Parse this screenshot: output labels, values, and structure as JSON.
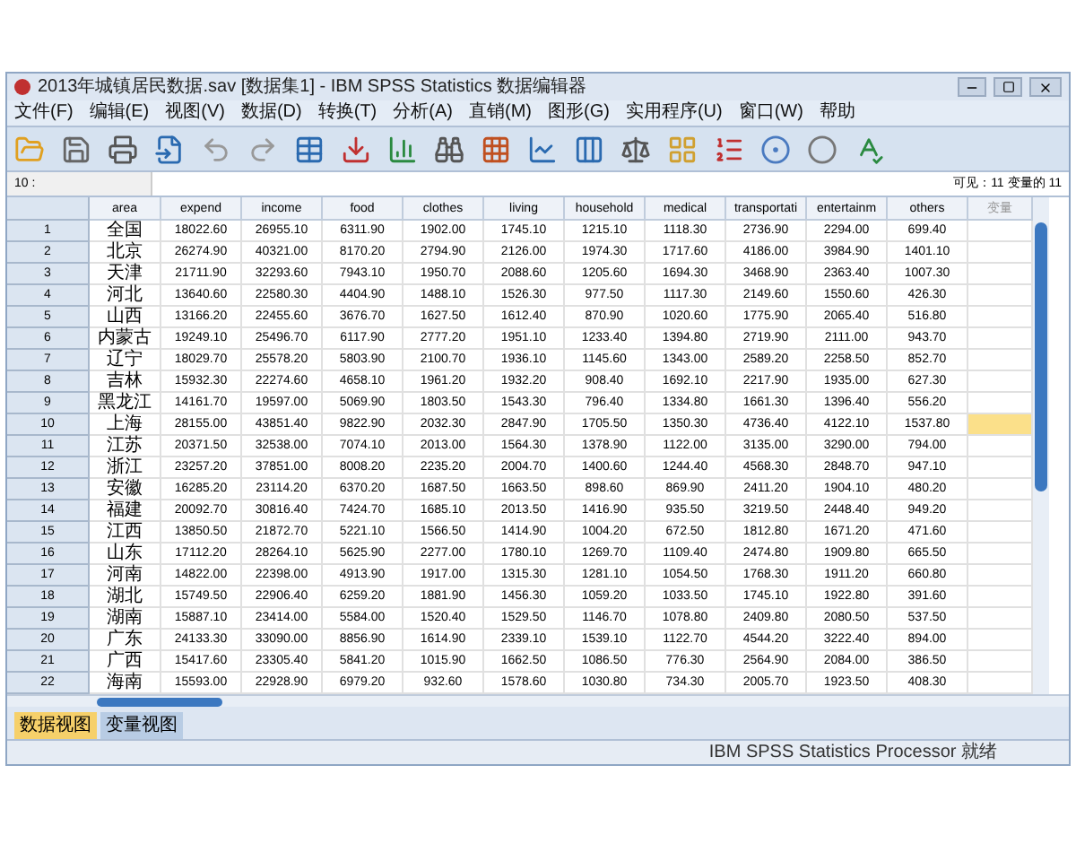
{
  "window": {
    "title": "2013年城镇居民数据.sav [数据集1] - IBM SPSS Statistics 数据编辑器"
  },
  "menu": [
    "文件(F)",
    "编辑(E)",
    "视图(V)",
    "数据(D)",
    "转换(T)",
    "分析(A)",
    "直销(M)",
    "图形(G)",
    "实用程序(U)",
    "窗口(W)",
    "帮助"
  ],
  "cell_editor": {
    "reference": "10 :",
    "visible_count": "可见：11 变量的 11"
  },
  "table": {
    "columns": [
      "area",
      "expend",
      "income",
      "food",
      "clothes",
      "living",
      "household",
      "medical",
      "transportati",
      "entertainm",
      "others",
      "变量"
    ],
    "rows": [
      {
        "number": "1",
        "cells": [
          "全国",
          "18022.60",
          "26955.10",
          "6311.90",
          "1902.00",
          "1745.10",
          "1215.10",
          "1118.30",
          "2736.90",
          "2294.00",
          "699.40"
        ],
        "selected": false
      },
      {
        "number": "2",
        "cells": [
          "北京",
          "26274.90",
          "40321.00",
          "8170.20",
          "2794.90",
          "2126.00",
          "1974.30",
          "1717.60",
          "4186.00",
          "3984.90",
          "1401.10"
        ],
        "selected": false
      },
      {
        "number": "3",
        "cells": [
          "天津",
          "21711.90",
          "32293.60",
          "7943.10",
          "1950.70",
          "2088.60",
          "1205.60",
          "1694.30",
          "3468.90",
          "2363.40",
          "1007.30"
        ],
        "selected": false
      },
      {
        "number": "4",
        "cells": [
          "河北",
          "13640.60",
          "22580.30",
          "4404.90",
          "1488.10",
          "1526.30",
          "977.50",
          "1117.30",
          "2149.60",
          "1550.60",
          "426.30"
        ],
        "selected": false
      },
      {
        "number": "5",
        "cells": [
          "山西",
          "13166.20",
          "22455.60",
          "3676.70",
          "1627.50",
          "1612.40",
          "870.90",
          "1020.60",
          "1775.90",
          "2065.40",
          "516.80"
        ],
        "selected": false
      },
      {
        "number": "6",
        "cells": [
          "内蒙古",
          "19249.10",
          "25496.70",
          "6117.90",
          "2777.20",
          "1951.10",
          "1233.40",
          "1394.80",
          "2719.90",
          "2111.00",
          "943.70"
        ],
        "selected": false
      },
      {
        "number": "7",
        "cells": [
          "辽宁",
          "18029.70",
          "25578.20",
          "5803.90",
          "2100.70",
          "1936.10",
          "1145.60",
          "1343.00",
          "2589.20",
          "2258.50",
          "852.70"
        ],
        "selected": false
      },
      {
        "number": "8",
        "cells": [
          "吉林",
          "15932.30",
          "22274.60",
          "4658.10",
          "1961.20",
          "1932.20",
          "908.40",
          "1692.10",
          "2217.90",
          "1935.00",
          "627.30"
        ],
        "selected": false
      },
      {
        "number": "9",
        "cells": [
          "黑龙江",
          "14161.70",
          "19597.00",
          "5069.90",
          "1803.50",
          "1543.30",
          "796.40",
          "1334.80",
          "1661.30",
          "1396.40",
          "556.20"
        ],
        "selected": false
      },
      {
        "number": "10",
        "cells": [
          "上海",
          "28155.00",
          "43851.40",
          "9822.90",
          "2032.30",
          "2847.90",
          "1705.50",
          "1350.30",
          "4736.40",
          "4122.10",
          "1537.80"
        ],
        "selected": true
      },
      {
        "number": "11",
        "cells": [
          "江苏",
          "20371.50",
          "32538.00",
          "7074.10",
          "2013.00",
          "1564.30",
          "1378.90",
          "1122.00",
          "3135.00",
          "3290.00",
          "794.00"
        ],
        "selected": false
      },
      {
        "number": "12",
        "cells": [
          "浙江",
          "23257.20",
          "37851.00",
          "8008.20",
          "2235.20",
          "2004.70",
          "1400.60",
          "1244.40",
          "4568.30",
          "2848.70",
          "947.10"
        ],
        "selected": false
      },
      {
        "number": "13",
        "cells": [
          "安徽",
          "16285.20",
          "23114.20",
          "6370.20",
          "1687.50",
          "1663.50",
          "898.60",
          "869.90",
          "2411.20",
          "1904.10",
          "480.20"
        ],
        "selected": false
      },
      {
        "number": "14",
        "cells": [
          "福建",
          "20092.70",
          "30816.40",
          "7424.70",
          "1685.10",
          "2013.50",
          "1416.90",
          "935.50",
          "3219.50",
          "2448.40",
          "949.20"
        ],
        "selected": false
      },
      {
        "number": "15",
        "cells": [
          "江西",
          "13850.50",
          "21872.70",
          "5221.10",
          "1566.50",
          "1414.90",
          "1004.20",
          "672.50",
          "1812.80",
          "1671.20",
          "471.60"
        ],
        "selected": false
      },
      {
        "number": "16",
        "cells": [
          "山东",
          "17112.20",
          "28264.10",
          "5625.90",
          "2277.00",
          "1780.10",
          "1269.70",
          "1109.40",
          "2474.80",
          "1909.80",
          "665.50"
        ],
        "selected": false
      },
      {
        "number": "17",
        "cells": [
          "河南",
          "14822.00",
          "22398.00",
          "4913.90",
          "1917.00",
          "1315.30",
          "1281.10",
          "1054.50",
          "1768.30",
          "1911.20",
          "660.80"
        ],
        "selected": false
      },
      {
        "number": "18",
        "cells": [
          "湖北",
          "15749.50",
          "22906.40",
          "6259.20",
          "1881.90",
          "1456.30",
          "1059.20",
          "1033.50",
          "1745.10",
          "1922.80",
          "391.60"
        ],
        "selected": false
      },
      {
        "number": "19",
        "cells": [
          "湖南",
          "15887.10",
          "23414.00",
          "5584.00",
          "1520.40",
          "1529.50",
          "1146.70",
          "1078.80",
          "2409.80",
          "2080.50",
          "537.50"
        ],
        "selected": false
      },
      {
        "number": "20",
        "cells": [
          "广东",
          "24133.30",
          "33090.00",
          "8856.90",
          "1614.90",
          "2339.10",
          "1539.10",
          "1122.70",
          "4544.20",
          "3222.40",
          "894.00"
        ],
        "selected": false
      },
      {
        "number": "21",
        "cells": [
          "广西",
          "15417.60",
          "23305.40",
          "5841.20",
          "1015.90",
          "1662.50",
          "1086.50",
          "776.30",
          "2564.90",
          "2084.00",
          "386.50"
        ],
        "selected": false
      },
      {
        "number": "22",
        "cells": [
          "海南",
          "15593.00",
          "22928.90",
          "6979.20",
          "932.60",
          "1578.60",
          "1030.80",
          "734.30",
          "2005.70",
          "1923.50",
          "408.30"
        ],
        "selected": false
      }
    ]
  },
  "view_tabs": [
    {
      "label": "数据视图",
      "selected": true
    },
    {
      "label": "变量视图",
      "selected": false
    }
  ],
  "status_bar": {
    "text": "IBM SPSS Statistics Processor 就绪"
  }
}
